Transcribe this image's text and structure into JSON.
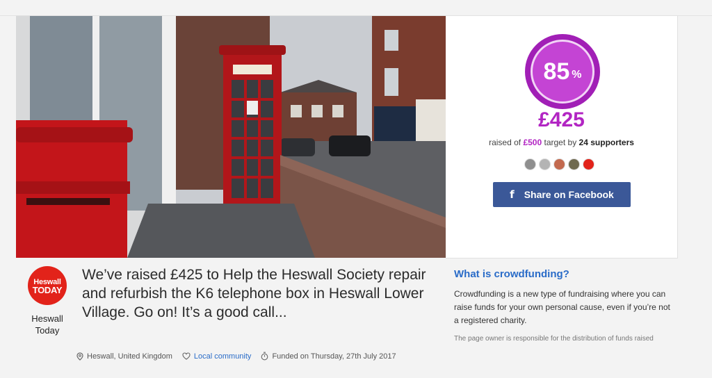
{
  "campaign": {
    "percent": "85",
    "percent_sign": "%",
    "raised": "£425",
    "raised_prefix": "raised of",
    "target": "£500",
    "target_word": "target by",
    "supporters": "24 supporters",
    "progress_fraction": 0.85
  },
  "share": {
    "label": "Share on Facebook",
    "icon": "facebook-icon"
  },
  "organiser": {
    "logo_line1": "Heswall",
    "logo_line2": "TODAY",
    "name_line1": "Heswall",
    "name_line2": "Today"
  },
  "headline": "We’ve raised £425 to Help the Heswall Society repair and refurbish the K6 telephone box in Heswall Lower Village. Go on! It’s a good call...",
  "meta": {
    "location": "Heswall, United Kingdom",
    "category": "Local community",
    "funded": "Funded on Thursday, 27th July 2017"
  },
  "info": {
    "title": "What is crowdfunding?",
    "body": "Crowdfunding is a new type of fundraising where you can raise funds for your own personal cause, even if you’re not a registered charity.",
    "note": "The page owner is responsible for the distribution of funds raised"
  },
  "colors": {
    "accent": "#b225c3",
    "link": "#2a6cc8",
    "facebook": "#3b5898",
    "brand_red": "#e2231a"
  }
}
